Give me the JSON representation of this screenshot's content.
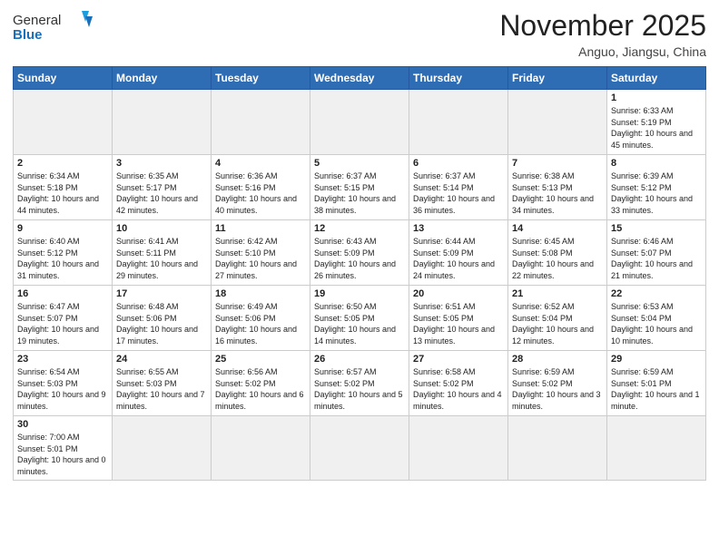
{
  "header": {
    "logo_general": "General",
    "logo_blue": "Blue",
    "month_title": "November 2025",
    "location": "Anguo, Jiangsu, China"
  },
  "weekdays": [
    "Sunday",
    "Monday",
    "Tuesday",
    "Wednesday",
    "Thursday",
    "Friday",
    "Saturday"
  ],
  "weeks": [
    [
      {
        "day": null
      },
      {
        "day": null
      },
      {
        "day": null
      },
      {
        "day": null
      },
      {
        "day": null
      },
      {
        "day": null
      },
      {
        "day": "1",
        "sunrise": "6:33 AM",
        "sunset": "5:19 PM",
        "daylight": "10 hours and 45 minutes."
      }
    ],
    [
      {
        "day": "2",
        "sunrise": "6:34 AM",
        "sunset": "5:18 PM",
        "daylight": "10 hours and 44 minutes."
      },
      {
        "day": "3",
        "sunrise": "6:35 AM",
        "sunset": "5:17 PM",
        "daylight": "10 hours and 42 minutes."
      },
      {
        "day": "4",
        "sunrise": "6:36 AM",
        "sunset": "5:16 PM",
        "daylight": "10 hours and 40 minutes."
      },
      {
        "day": "5",
        "sunrise": "6:37 AM",
        "sunset": "5:15 PM",
        "daylight": "10 hours and 38 minutes."
      },
      {
        "day": "6",
        "sunrise": "6:37 AM",
        "sunset": "5:14 PM",
        "daylight": "10 hours and 36 minutes."
      },
      {
        "day": "7",
        "sunrise": "6:38 AM",
        "sunset": "5:13 PM",
        "daylight": "10 hours and 34 minutes."
      },
      {
        "day": "8",
        "sunrise": "6:39 AM",
        "sunset": "5:12 PM",
        "daylight": "10 hours and 33 minutes."
      }
    ],
    [
      {
        "day": "9",
        "sunrise": "6:40 AM",
        "sunset": "5:12 PM",
        "daylight": "10 hours and 31 minutes."
      },
      {
        "day": "10",
        "sunrise": "6:41 AM",
        "sunset": "5:11 PM",
        "daylight": "10 hours and 29 minutes."
      },
      {
        "day": "11",
        "sunrise": "6:42 AM",
        "sunset": "5:10 PM",
        "daylight": "10 hours and 27 minutes."
      },
      {
        "day": "12",
        "sunrise": "6:43 AM",
        "sunset": "5:09 PM",
        "daylight": "10 hours and 26 minutes."
      },
      {
        "day": "13",
        "sunrise": "6:44 AM",
        "sunset": "5:09 PM",
        "daylight": "10 hours and 24 minutes."
      },
      {
        "day": "14",
        "sunrise": "6:45 AM",
        "sunset": "5:08 PM",
        "daylight": "10 hours and 22 minutes."
      },
      {
        "day": "15",
        "sunrise": "6:46 AM",
        "sunset": "5:07 PM",
        "daylight": "10 hours and 21 minutes."
      }
    ],
    [
      {
        "day": "16",
        "sunrise": "6:47 AM",
        "sunset": "5:07 PM",
        "daylight": "10 hours and 19 minutes."
      },
      {
        "day": "17",
        "sunrise": "6:48 AM",
        "sunset": "5:06 PM",
        "daylight": "10 hours and 17 minutes."
      },
      {
        "day": "18",
        "sunrise": "6:49 AM",
        "sunset": "5:06 PM",
        "daylight": "10 hours and 16 minutes."
      },
      {
        "day": "19",
        "sunrise": "6:50 AM",
        "sunset": "5:05 PM",
        "daylight": "10 hours and 14 minutes."
      },
      {
        "day": "20",
        "sunrise": "6:51 AM",
        "sunset": "5:05 PM",
        "daylight": "10 hours and 13 minutes."
      },
      {
        "day": "21",
        "sunrise": "6:52 AM",
        "sunset": "5:04 PM",
        "daylight": "10 hours and 12 minutes."
      },
      {
        "day": "22",
        "sunrise": "6:53 AM",
        "sunset": "5:04 PM",
        "daylight": "10 hours and 10 minutes."
      }
    ],
    [
      {
        "day": "23",
        "sunrise": "6:54 AM",
        "sunset": "5:03 PM",
        "daylight": "10 hours and 9 minutes."
      },
      {
        "day": "24",
        "sunrise": "6:55 AM",
        "sunset": "5:03 PM",
        "daylight": "10 hours and 7 minutes."
      },
      {
        "day": "25",
        "sunrise": "6:56 AM",
        "sunset": "5:02 PM",
        "daylight": "10 hours and 6 minutes."
      },
      {
        "day": "26",
        "sunrise": "6:57 AM",
        "sunset": "5:02 PM",
        "daylight": "10 hours and 5 minutes."
      },
      {
        "day": "27",
        "sunrise": "6:58 AM",
        "sunset": "5:02 PM",
        "daylight": "10 hours and 4 minutes."
      },
      {
        "day": "28",
        "sunrise": "6:59 AM",
        "sunset": "5:02 PM",
        "daylight": "10 hours and 3 minutes."
      },
      {
        "day": "29",
        "sunrise": "6:59 AM",
        "sunset": "5:01 PM",
        "daylight": "10 hours and 1 minute."
      }
    ],
    [
      {
        "day": "30",
        "sunrise": "7:00 AM",
        "sunset": "5:01 PM",
        "daylight": "10 hours and 0 minutes."
      },
      {
        "day": null
      },
      {
        "day": null
      },
      {
        "day": null
      },
      {
        "day": null
      },
      {
        "day": null
      },
      {
        "day": null
      }
    ]
  ],
  "labels": {
    "sunrise": "Sunrise:",
    "sunset": "Sunset:",
    "daylight": "Daylight:"
  }
}
